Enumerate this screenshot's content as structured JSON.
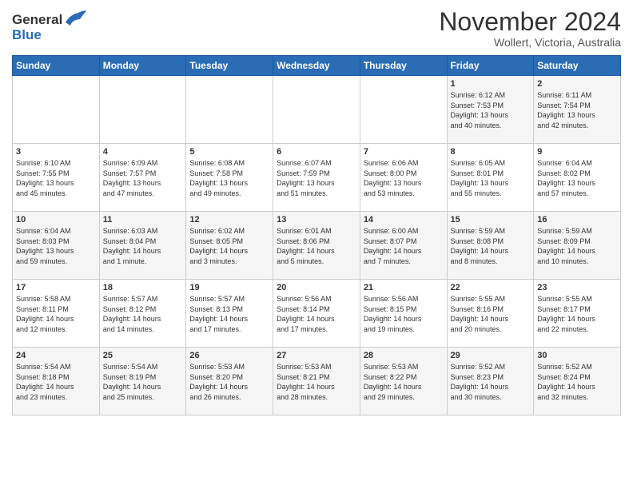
{
  "header": {
    "logo_line1": "General",
    "logo_line2": "Blue",
    "month_title": "November 2024",
    "location": "Wollert, Victoria, Australia"
  },
  "weekdays": [
    "Sunday",
    "Monday",
    "Tuesday",
    "Wednesday",
    "Thursday",
    "Friday",
    "Saturday"
  ],
  "weeks": [
    [
      {
        "day": "",
        "info": ""
      },
      {
        "day": "",
        "info": ""
      },
      {
        "day": "",
        "info": ""
      },
      {
        "day": "",
        "info": ""
      },
      {
        "day": "",
        "info": ""
      },
      {
        "day": "1",
        "info": "Sunrise: 6:12 AM\nSunset: 7:53 PM\nDaylight: 13 hours\nand 40 minutes."
      },
      {
        "day": "2",
        "info": "Sunrise: 6:11 AM\nSunset: 7:54 PM\nDaylight: 13 hours\nand 42 minutes."
      }
    ],
    [
      {
        "day": "3",
        "info": "Sunrise: 6:10 AM\nSunset: 7:55 PM\nDaylight: 13 hours\nand 45 minutes."
      },
      {
        "day": "4",
        "info": "Sunrise: 6:09 AM\nSunset: 7:57 PM\nDaylight: 13 hours\nand 47 minutes."
      },
      {
        "day": "5",
        "info": "Sunrise: 6:08 AM\nSunset: 7:58 PM\nDaylight: 13 hours\nand 49 minutes."
      },
      {
        "day": "6",
        "info": "Sunrise: 6:07 AM\nSunset: 7:59 PM\nDaylight: 13 hours\nand 51 minutes."
      },
      {
        "day": "7",
        "info": "Sunrise: 6:06 AM\nSunset: 8:00 PM\nDaylight: 13 hours\nand 53 minutes."
      },
      {
        "day": "8",
        "info": "Sunrise: 6:05 AM\nSunset: 8:01 PM\nDaylight: 13 hours\nand 55 minutes."
      },
      {
        "day": "9",
        "info": "Sunrise: 6:04 AM\nSunset: 8:02 PM\nDaylight: 13 hours\nand 57 minutes."
      }
    ],
    [
      {
        "day": "10",
        "info": "Sunrise: 6:04 AM\nSunset: 8:03 PM\nDaylight: 13 hours\nand 59 minutes."
      },
      {
        "day": "11",
        "info": "Sunrise: 6:03 AM\nSunset: 8:04 PM\nDaylight: 14 hours\nand 1 minute."
      },
      {
        "day": "12",
        "info": "Sunrise: 6:02 AM\nSunset: 8:05 PM\nDaylight: 14 hours\nand 3 minutes."
      },
      {
        "day": "13",
        "info": "Sunrise: 6:01 AM\nSunset: 8:06 PM\nDaylight: 14 hours\nand 5 minutes."
      },
      {
        "day": "14",
        "info": "Sunrise: 6:00 AM\nSunset: 8:07 PM\nDaylight: 14 hours\nand 7 minutes."
      },
      {
        "day": "15",
        "info": "Sunrise: 5:59 AM\nSunset: 8:08 PM\nDaylight: 14 hours\nand 8 minutes."
      },
      {
        "day": "16",
        "info": "Sunrise: 5:59 AM\nSunset: 8:09 PM\nDaylight: 14 hours\nand 10 minutes."
      }
    ],
    [
      {
        "day": "17",
        "info": "Sunrise: 5:58 AM\nSunset: 8:11 PM\nDaylight: 14 hours\nand 12 minutes."
      },
      {
        "day": "18",
        "info": "Sunrise: 5:57 AM\nSunset: 8:12 PM\nDaylight: 14 hours\nand 14 minutes."
      },
      {
        "day": "19",
        "info": "Sunrise: 5:57 AM\nSunset: 8:13 PM\nDaylight: 14 hours\nand 17 minutes."
      },
      {
        "day": "20",
        "info": "Sunrise: 5:56 AM\nSunset: 8:14 PM\nDaylight: 14 hours\nand 17 minutes."
      },
      {
        "day": "21",
        "info": "Sunrise: 5:56 AM\nSunset: 8:15 PM\nDaylight: 14 hours\nand 19 minutes."
      },
      {
        "day": "22",
        "info": "Sunrise: 5:55 AM\nSunset: 8:16 PM\nDaylight: 14 hours\nand 20 minutes."
      },
      {
        "day": "23",
        "info": "Sunrise: 5:55 AM\nSunset: 8:17 PM\nDaylight: 14 hours\nand 22 minutes."
      }
    ],
    [
      {
        "day": "24",
        "info": "Sunrise: 5:54 AM\nSunset: 8:18 PM\nDaylight: 14 hours\nand 23 minutes."
      },
      {
        "day": "25",
        "info": "Sunrise: 5:54 AM\nSunset: 8:19 PM\nDaylight: 14 hours\nand 25 minutes."
      },
      {
        "day": "26",
        "info": "Sunrise: 5:53 AM\nSunset: 8:20 PM\nDaylight: 14 hours\nand 26 minutes."
      },
      {
        "day": "27",
        "info": "Sunrise: 5:53 AM\nSunset: 8:21 PM\nDaylight: 14 hours\nand 28 minutes."
      },
      {
        "day": "28",
        "info": "Sunrise: 5:53 AM\nSunset: 8:22 PM\nDaylight: 14 hours\nand 29 minutes."
      },
      {
        "day": "29",
        "info": "Sunrise: 5:52 AM\nSunset: 8:23 PM\nDaylight: 14 hours\nand 30 minutes."
      },
      {
        "day": "30",
        "info": "Sunrise: 5:52 AM\nSunset: 8:24 PM\nDaylight: 14 hours\nand 32 minutes."
      }
    ]
  ]
}
